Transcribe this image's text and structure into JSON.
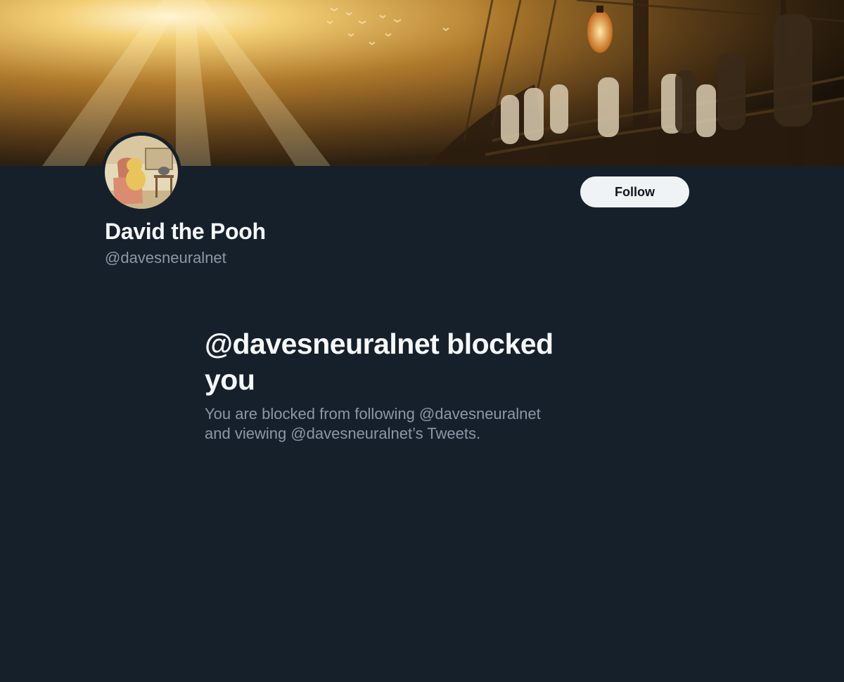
{
  "profile": {
    "display_name": "David the Pooh",
    "handle": "@davesneuralnet"
  },
  "actions": {
    "follow_label": "Follow"
  },
  "blocked_notice": {
    "title": "@davesneuralnet blocked you",
    "description": "You are blocked from following @davesneuralnet and viewing @davesneuralnet’s Tweets."
  },
  "theme": {
    "background": "#15202b",
    "primary_text": "#f7f9f9",
    "secondary_text": "#8b98a5",
    "button_bg": "#eff3f4",
    "button_text": "#0f1419"
  },
  "icons": {
    "banner": "banner-image",
    "avatar": "avatar-image"
  }
}
